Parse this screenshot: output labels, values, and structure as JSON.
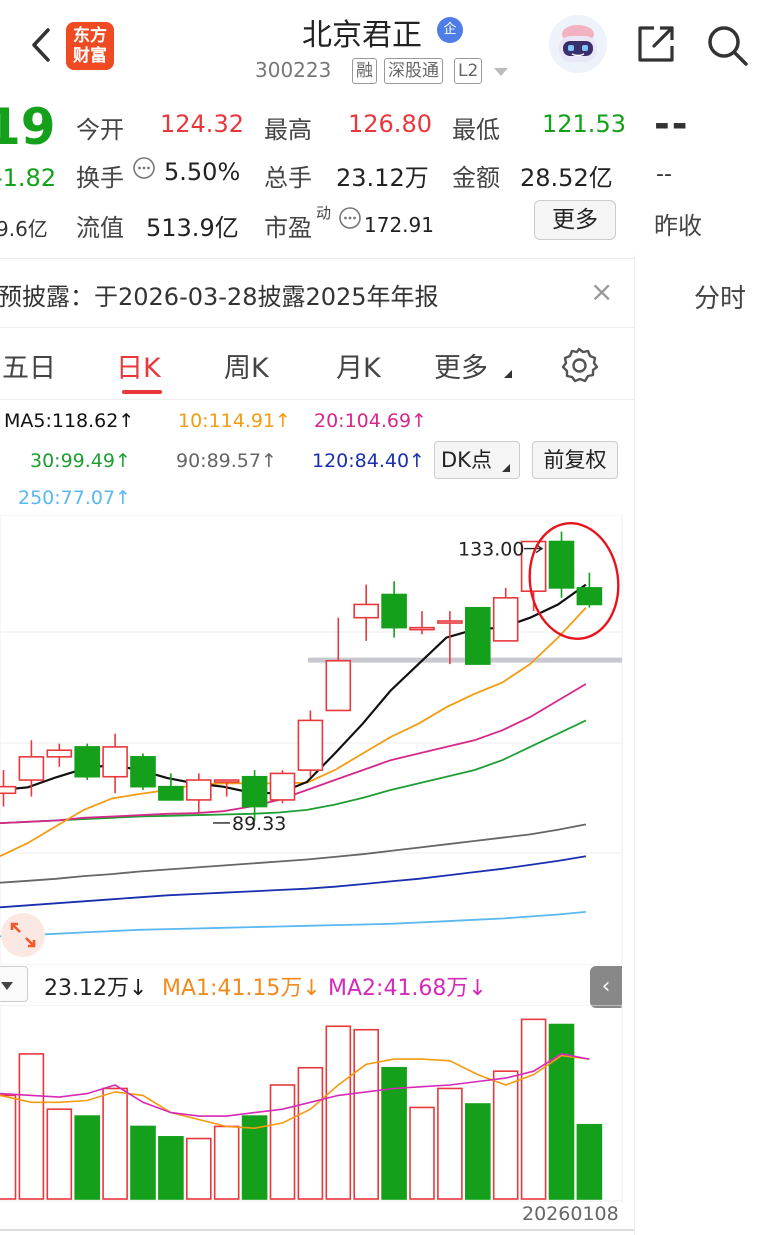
{
  "header": {
    "logo_line1": "东方",
    "logo_line2": "财富",
    "stock_name": "北京君正",
    "badge": "企",
    "stock_code": "300223",
    "tags": [
      "融",
      "深股通",
      "L2"
    ]
  },
  "quote": {
    "price_partial": "19",
    "change_partial": "-1.82",
    "cap_partial": "9.6亿",
    "rows": [
      [
        {
          "label": "今开",
          "value": "124.32",
          "color": "red"
        },
        {
          "label": "最高",
          "value": "126.80",
          "color": "red"
        },
        {
          "label": "最低",
          "value": "121.53",
          "color": "green"
        }
      ],
      [
        {
          "label": "换手",
          "value": "5.50%",
          "color": "dark"
        },
        {
          "label": "总手",
          "value": "23.12万",
          "color": "dark"
        },
        {
          "label": "金额",
          "value": "28.52亿",
          "color": "dark"
        }
      ],
      [
        {
          "label": "流值",
          "value": "513.9亿",
          "color": "dark"
        },
        {
          "label": "市盈",
          "sup": "动",
          "value": "172.91",
          "color": "dark"
        }
      ]
    ],
    "more_label": "更多",
    "right_dash": "--",
    "right_dash2": "--",
    "right_yest": "昨收"
  },
  "notice": {
    "text": "预披露：于2026-03-28披露2025年年报",
    "close": "×"
  },
  "side_tab": "分时",
  "tabs": {
    "items": [
      "五日",
      "日K",
      "周K",
      "月K",
      "更多"
    ]
  },
  "ma_legend": {
    "ma5": "MA5:118.62↑",
    "ma10": "10:114.91↑",
    "ma20": "20:104.69↑",
    "ma30": "30:99.49↑",
    "ma90": "90:89.57↑",
    "ma120": "120:84.40↑",
    "ma250": "250:77.07↑",
    "dk_label": "DK点",
    "fq_label": "前复权"
  },
  "colors": {
    "up": "#e8383c",
    "down": "#14a01a",
    "ma5": "#111111",
    "ma10": "#f39c12",
    "ma20": "#d6288a",
    "ma30": "#1f9e33",
    "ma90": "#666666",
    "ma120": "#1a2fb0",
    "ma250": "#5bb8ef"
  },
  "chart_data": {
    "type": "candlestick",
    "high_label": "133.00",
    "low_label": "89.33",
    "candles": [
      {
        "o": 93.5,
        "c": 94.5,
        "h": 97.0,
        "l": 91.5
      },
      {
        "o": 95.5,
        "c": 99.0,
        "h": 101.5,
        "l": 93.0
      },
      {
        "o": 99.0,
        "c": 100.0,
        "h": 101.0,
        "l": 97.5
      },
      {
        "o": 100.5,
        "c": 96.0,
        "h": 101.0,
        "l": 95.5
      },
      {
        "o": 96.0,
        "c": 100.5,
        "h": 102.5,
        "l": 93.5
      },
      {
        "o": 99.0,
        "c": 94.5,
        "h": 99.5,
        "l": 94.0
      },
      {
        "o": 94.5,
        "c": 92.5,
        "h": 96.5,
        "l": 92.5
      },
      {
        "o": 92.5,
        "c": 95.5,
        "h": 96.5,
        "l": 90.5
      },
      {
        "o": 95.5,
        "c": 95.5,
        "h": 95.5,
        "l": 93.0
      },
      {
        "o": 96.0,
        "c": 91.5,
        "h": 97.0,
        "l": 89.33
      },
      {
        "o": 92.5,
        "c": 96.5,
        "h": 97.0,
        "l": 92.0
      },
      {
        "o": 97.0,
        "c": 104.5,
        "h": 106.0,
        "l": 96.0
      },
      {
        "o": 106.0,
        "c": 113.5,
        "h": 120.0,
        "l": 106.0
      },
      {
        "o": 120.0,
        "c": 122.0,
        "h": 125.0,
        "l": 116.5
      },
      {
        "o": 123.5,
        "c": 118.5,
        "h": 125.5,
        "l": 117.0
      },
      {
        "o": 118.5,
        "c": 118.5,
        "h": 121.0,
        "l": 117.5
      },
      {
        "o": 119.5,
        "c": 119.5,
        "h": 121.0,
        "l": 113.0
      },
      {
        "o": 121.5,
        "c": 113.0,
        "h": 121.5,
        "l": 113.0
      },
      {
        "o": 116.5,
        "c": 123.0,
        "h": 124.5,
        "l": 116.5
      },
      {
        "o": 124.0,
        "c": 131.5,
        "h": 131.5,
        "l": 121.0
      },
      {
        "o": 131.5,
        "c": 124.5,
        "h": 133.0,
        "l": 123.0
      },
      {
        "o": 124.5,
        "c": 122.0,
        "h": 126.8,
        "l": 121.53
      }
    ],
    "ma5": [
      94.0,
      94.4,
      95.9,
      97.2,
      97.8,
      97.0,
      95.8,
      95.0,
      94.5,
      93.6,
      93.5,
      95.2,
      99.5,
      104.0,
      109.0,
      113.0,
      117.0,
      118.2,
      118.5,
      120.0,
      122.0,
      125.0
    ],
    "ma10": [
      84.0,
      86.0,
      88.5,
      91.0,
      92.7,
      93.4,
      94.0,
      94.8,
      95.0,
      95.0,
      95.0,
      95.1,
      97.0,
      99.5,
      102.0,
      104.0,
      106.5,
      108.5,
      110.2,
      113.0,
      117.0,
      121.5
    ],
    "ma20": [
      89.0,
      89.2,
      89.4,
      89.8,
      90.0,
      90.2,
      90.4,
      90.5,
      90.8,
      91.5,
      92.5,
      94.0,
      95.5,
      97.0,
      98.5,
      99.5,
      100.5,
      101.5,
      103.0,
      105.0,
      107.5,
      110.0
    ],
    "ma30": [
      89.0,
      89.2,
      89.4,
      89.6,
      89.8,
      90.0,
      90.1,
      90.2,
      90.3,
      90.4,
      90.6,
      91.0,
      91.8,
      92.8,
      94.0,
      95.0,
      96.0,
      97.0,
      98.5,
      100.5,
      102.5,
      104.5
    ],
    "ma90": [
      80.0,
      80.3,
      80.6,
      81.0,
      81.3,
      81.7,
      82.0,
      82.3,
      82.6,
      82.9,
      83.2,
      83.5,
      83.9,
      84.3,
      84.8,
      85.3,
      85.8,
      86.3,
      86.8,
      87.3,
      88.0,
      88.8
    ],
    "ma120": [
      76.3,
      76.6,
      76.9,
      77.2,
      77.5,
      77.8,
      78.1,
      78.3,
      78.5,
      78.7,
      78.9,
      79.1,
      79.4,
      79.8,
      80.2,
      80.6,
      81.1,
      81.6,
      82.1,
      82.7,
      83.3,
      84.0
    ],
    "ma250": [
      71.9,
      72.1,
      72.3,
      72.5,
      72.7,
      72.9,
      73.0,
      73.1,
      73.2,
      73.3,
      73.4,
      73.5,
      73.6,
      73.7,
      73.8,
      74.0,
      74.2,
      74.4,
      74.6,
      74.9,
      75.2,
      75.6
    ],
    "volume": {
      "header_value": "23.12万↓",
      "ma1": "MA1:41.15万↓",
      "ma2": "MA2:41.68万↓",
      "bars": [
        30.0,
        42.0,
        26.0,
        24.0,
        32.0,
        21.0,
        18.0,
        17.5,
        21.0,
        24.0,
        33.0,
        38.0,
        50.0,
        49.0,
        38.0,
        26.5,
        32.0,
        27.5,
        37.0,
        52.0,
        50.5,
        21.5
      ],
      "ma1_line": [
        30.0,
        28.0,
        28.0,
        28.5,
        31.0,
        30.0,
        25.0,
        23.0,
        21.0,
        20.5,
        22.0,
        26.0,
        33.0,
        39.0,
        40.5,
        40.5,
        40.0,
        36.0,
        33.0,
        36.0,
        41.5,
        40.5
      ],
      "ma2_line": [
        30.5,
        30.0,
        29.5,
        30.5,
        33.0,
        28.0,
        25.0,
        24.0,
        24.0,
        25.0,
        26.0,
        28.0,
        30.0,
        31.0,
        32.0,
        32.5,
        33.0,
        34.0,
        35.0,
        37.0,
        42.0,
        40.5
      ]
    },
    "date_label": "20260108"
  }
}
